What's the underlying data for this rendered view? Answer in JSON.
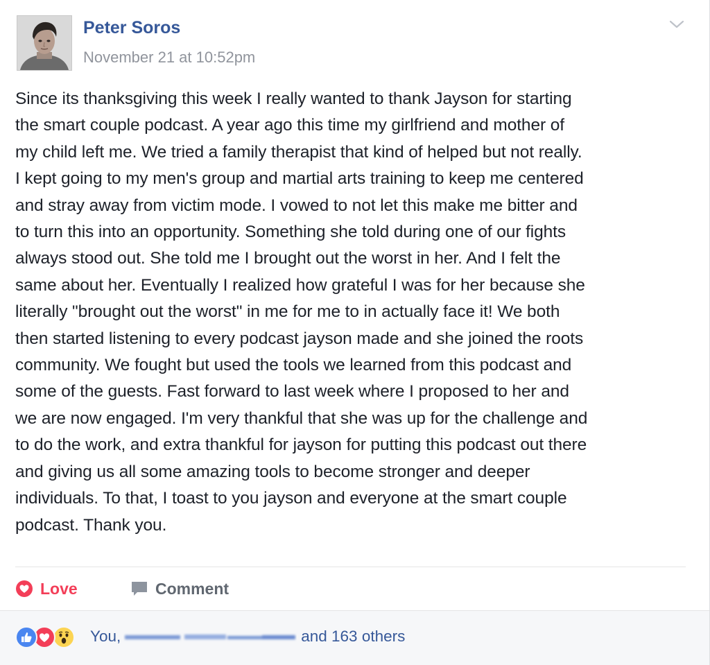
{
  "post": {
    "author_name": "Peter Soros",
    "timestamp": "November 21 at 10:52pm",
    "body_lines": [
      "Since its thanksgiving this week I really wanted to thank Jayson for starting",
      "the smart couple podcast. A year ago this time my girlfriend and mother of",
      "my child left me. We tried a family therapist that kind of helped but not really.",
      "I kept going to my men's group and martial arts training to keep me centered",
      "and stray away from victim mode. I vowed to not let this make me bitter and",
      "to turn this into an opportunity. Something she told during one of our fights",
      "always stood out. She told me I brought out the worst in her. And I felt the",
      "same about her. Eventually I realized how grateful I was for her because she",
      "literally \"brought out the worst\" in me for me to in actually face it! We both",
      "then started listening to every podcast jayson made and she joined the roots",
      "community. We fought but used the tools we learned from this podcast and",
      "some of the guests. Fast forward to last week where I proposed to her and",
      "we are now engaged. I'm very thankful that she was up for the challenge and",
      "to do the work, and extra thankful for jayson for putting this podcast out there",
      "and giving us all some amazing tools to become stronger and deeper",
      "individuals. To that, I toast to you jayson and everyone at the smart couple",
      "podcast. Thank you."
    ]
  },
  "actions": {
    "love_label": "Love",
    "comment_label": "Comment"
  },
  "reactions": {
    "icons": [
      "like-icon",
      "love-icon",
      "wow-icon"
    ],
    "you_text": "You,",
    "others_text": "and 163 others"
  },
  "colors": {
    "author_blue": "#365899",
    "love_red": "#f33e58",
    "muted_gray": "#90949c",
    "text_dark": "#1d2129",
    "like_blue": "#4a86f0",
    "wow_yellow": "#fcd452",
    "bar_bg": "#f6f7f9"
  }
}
